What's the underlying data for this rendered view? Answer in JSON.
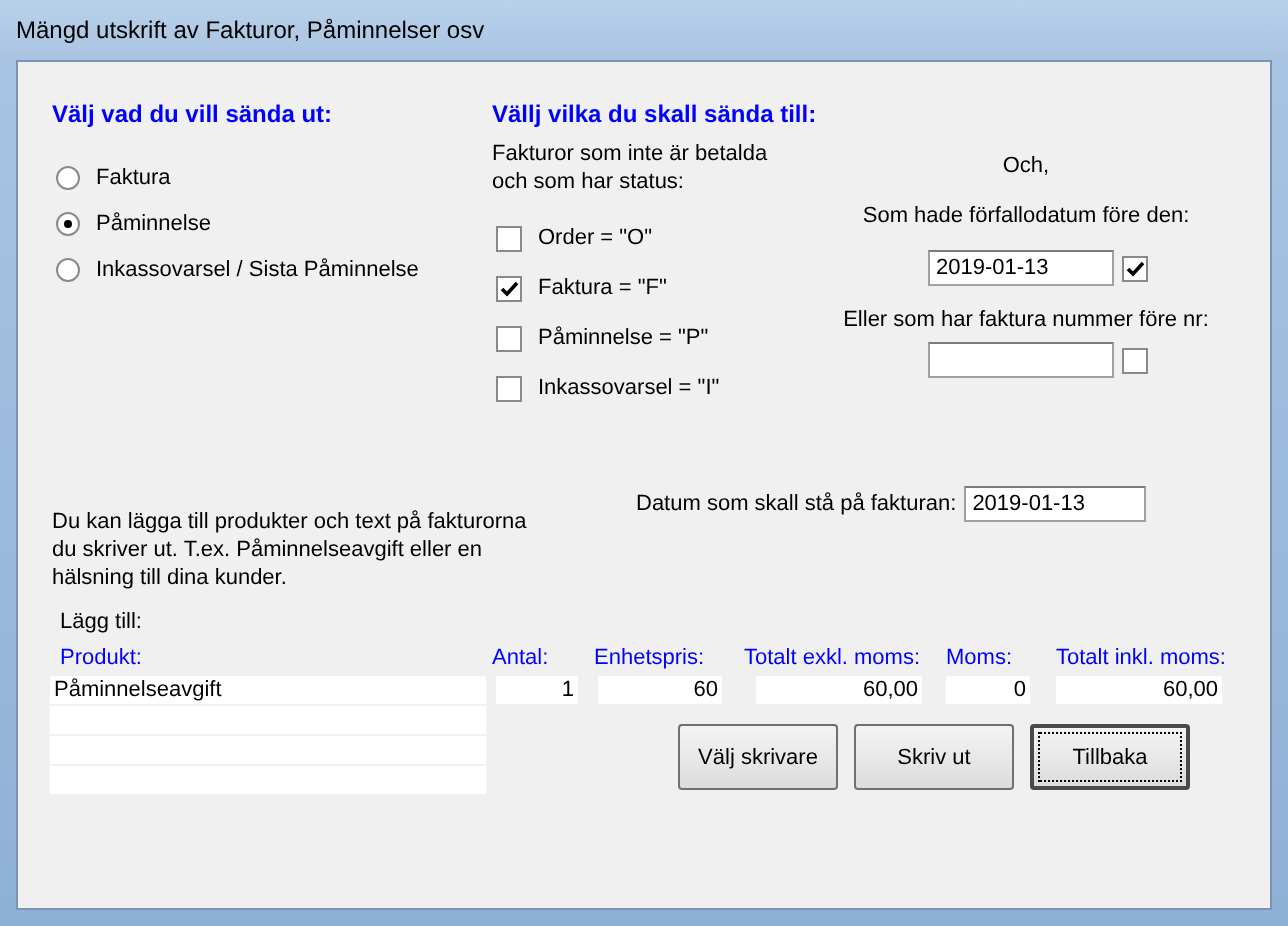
{
  "window": {
    "title": "Mängd utskrift av Fakturor, Påminnelser osv"
  },
  "send_type": {
    "heading": "Välj vad du vill sända ut:",
    "options": [
      {
        "label": "Faktura",
        "selected": false
      },
      {
        "label": "Påminnelse",
        "selected": true
      },
      {
        "label": "Inkassovarsel / Sista Påminnelse",
        "selected": false
      }
    ]
  },
  "recipients": {
    "heading": "Vällj vilka du skall sända till:",
    "status_note": "Fakturor som inte är betalda\noch som har status:",
    "statuses": [
      {
        "label": "Order = \"O\"",
        "checked": false
      },
      {
        "label": "Faktura = \"F\"",
        "checked": true
      },
      {
        "label": "Påminnelse = \"P\"",
        "checked": false
      },
      {
        "label": "Inkassovarsel = \"I\"",
        "checked": false
      }
    ]
  },
  "and_label": "Och,",
  "due_date": {
    "label": "Som hade förfallodatum före den:",
    "value": "2019-01-13",
    "checked": true
  },
  "invoice_number": {
    "label": "Eller som har faktura nummer före nr:",
    "checked": false
  },
  "info_text": "Du kan lägga till produkter och text på fakturorna du skriver ut. T.ex. Påminnelseavgift eller en hälsning till dina kunder.",
  "invoice_date": {
    "label": "Datum som skall stå på fakturan:",
    "value": "2019-01-13"
  },
  "add_label": "Lägg till:",
  "products": {
    "columns": [
      "Produkt:",
      "Antal:",
      "Enhetspris:",
      "Totalt exkl. moms:",
      "Moms:",
      "Totalt inkl. moms:"
    ],
    "rows": [
      {
        "kind": "item",
        "cells": [
          "Påminnelseavgift",
          "1",
          "60",
          "60,00",
          "0",
          "60,00"
        ]
      },
      {
        "kind": "blank"
      },
      {
        "kind": "blank"
      },
      {
        "kind": "blank"
      }
    ]
  },
  "buttons": [
    {
      "label": "Välj skrivare",
      "default": false
    },
    {
      "label": "Skriv ut",
      "default": false
    },
    {
      "label": "Tillbaka",
      "default": true
    }
  ]
}
